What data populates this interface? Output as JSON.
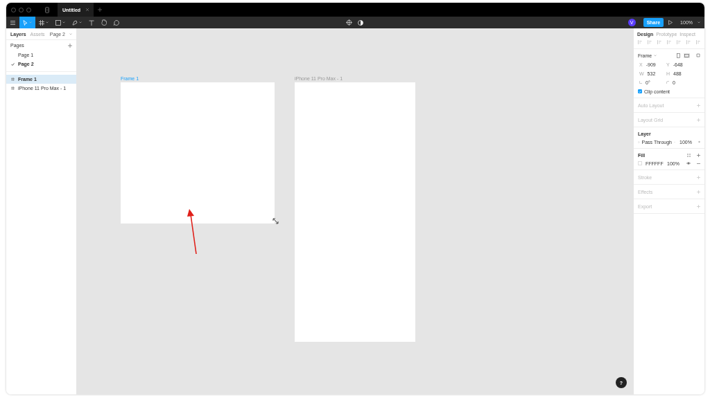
{
  "title_bar": {
    "tabs": [
      {
        "label": "Untitled",
        "selected": true
      }
    ]
  },
  "toolbar": {
    "tools": [
      {
        "kind": "move",
        "selected": true
      },
      {
        "kind": "frame",
        "selected": false
      },
      {
        "kind": "shape",
        "selected": false
      },
      {
        "kind": "pen",
        "selected": false
      },
      {
        "kind": "text",
        "selected": false
      },
      {
        "kind": "hand",
        "selected": false
      },
      {
        "kind": "comment",
        "selected": false
      }
    ],
    "avatar": "V",
    "share": "Share",
    "zoom": "100%"
  },
  "left_panel": {
    "tabs": [
      {
        "label": "Layers",
        "selected": true
      },
      {
        "label": "Assets",
        "selected": false
      }
    ],
    "page_menu": "Page 2",
    "pages_heading": "Pages",
    "pages": [
      {
        "label": "Page 1",
        "selected": false
      },
      {
        "label": "Page 2",
        "selected": true
      }
    ],
    "layers": [
      {
        "label": "Frame 1",
        "selected": true
      },
      {
        "label": "iPhone 11 Pro Max - 1",
        "selected": false
      }
    ]
  },
  "canvas": {
    "frames": [
      {
        "label": "Frame 1",
        "selected": true
      },
      {
        "label": "iPhone 11 Pro Max - 1",
        "selected": false
      }
    ]
  },
  "right_panel": {
    "tabs": [
      {
        "label": "Design",
        "selected": true
      },
      {
        "label": "Prototype",
        "selected": false
      },
      {
        "label": "Inspect",
        "selected": false
      }
    ],
    "frame_menu": "Frame",
    "fields": [
      {
        "prefix": "X",
        "value": "-909"
      },
      {
        "prefix": "Y",
        "value": "-648"
      },
      {
        "prefix": "W",
        "value": "532"
      },
      {
        "prefix": "H",
        "value": "488"
      }
    ],
    "rotation": "0°",
    "radius": "0",
    "clip_content": {
      "label": "Clip content",
      "checked": true
    },
    "auto_layout": "Auto Layout",
    "layout_grid": "Layout Grid",
    "layer": {
      "heading": "Layer",
      "blend": "Pass Through",
      "opacity": "100%"
    },
    "fill": {
      "heading": "Fill",
      "hex": "FFFFFF",
      "opacity": "100%"
    },
    "empty_sections": [
      "Stroke",
      "Effects",
      "Export"
    ]
  },
  "help": "?"
}
